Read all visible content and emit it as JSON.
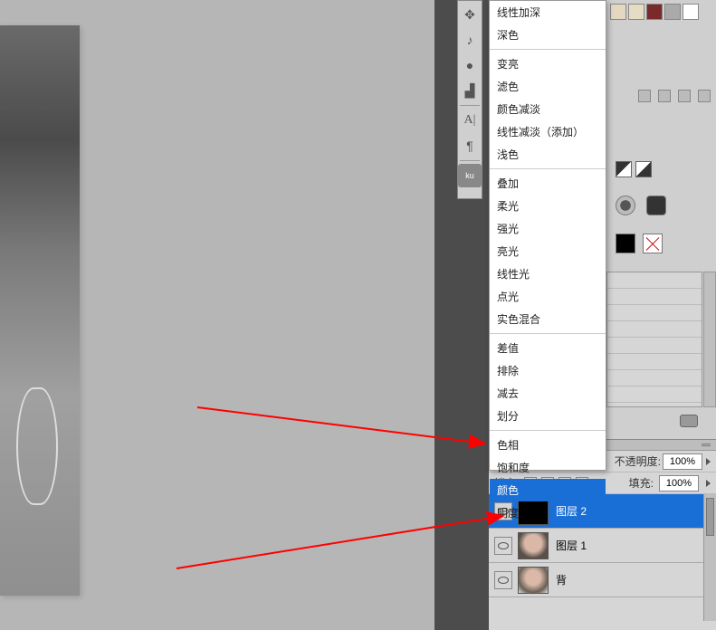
{
  "blend_modes": {
    "group1": [
      "线性加深",
      "深色"
    ],
    "group2": [
      "变亮",
      "滤色",
      "颜色减淡",
      "线性减淡（添加）",
      "浅色"
    ],
    "group3": [
      "叠加",
      "柔光",
      "强光",
      "亮光",
      "线性光",
      "点光",
      "实色混合"
    ],
    "group4": [
      "差值",
      "排除",
      "减去",
      "划分"
    ],
    "group5": [
      "色相",
      "饱和度",
      "颜色",
      "明度"
    ],
    "selected": "颜色"
  },
  "toolbar_icons": [
    "move-icon",
    "path-icon",
    "blob-icon",
    "stamp-icon",
    "text-a-icon",
    "paragraph-icon",
    "kuler-icon"
  ],
  "layers": {
    "opacity_label": "不透明度:",
    "opacity_value": "100%",
    "lock_label": "锁定:",
    "fill_label": "填充:",
    "fill_value": "100%",
    "items": [
      {
        "name": "图层 2",
        "selected": true,
        "thumb": "black"
      },
      {
        "name": "图层 1",
        "selected": false,
        "thumb": "face"
      },
      {
        "name": "背",
        "selected": false,
        "thumb": "face2"
      }
    ]
  }
}
